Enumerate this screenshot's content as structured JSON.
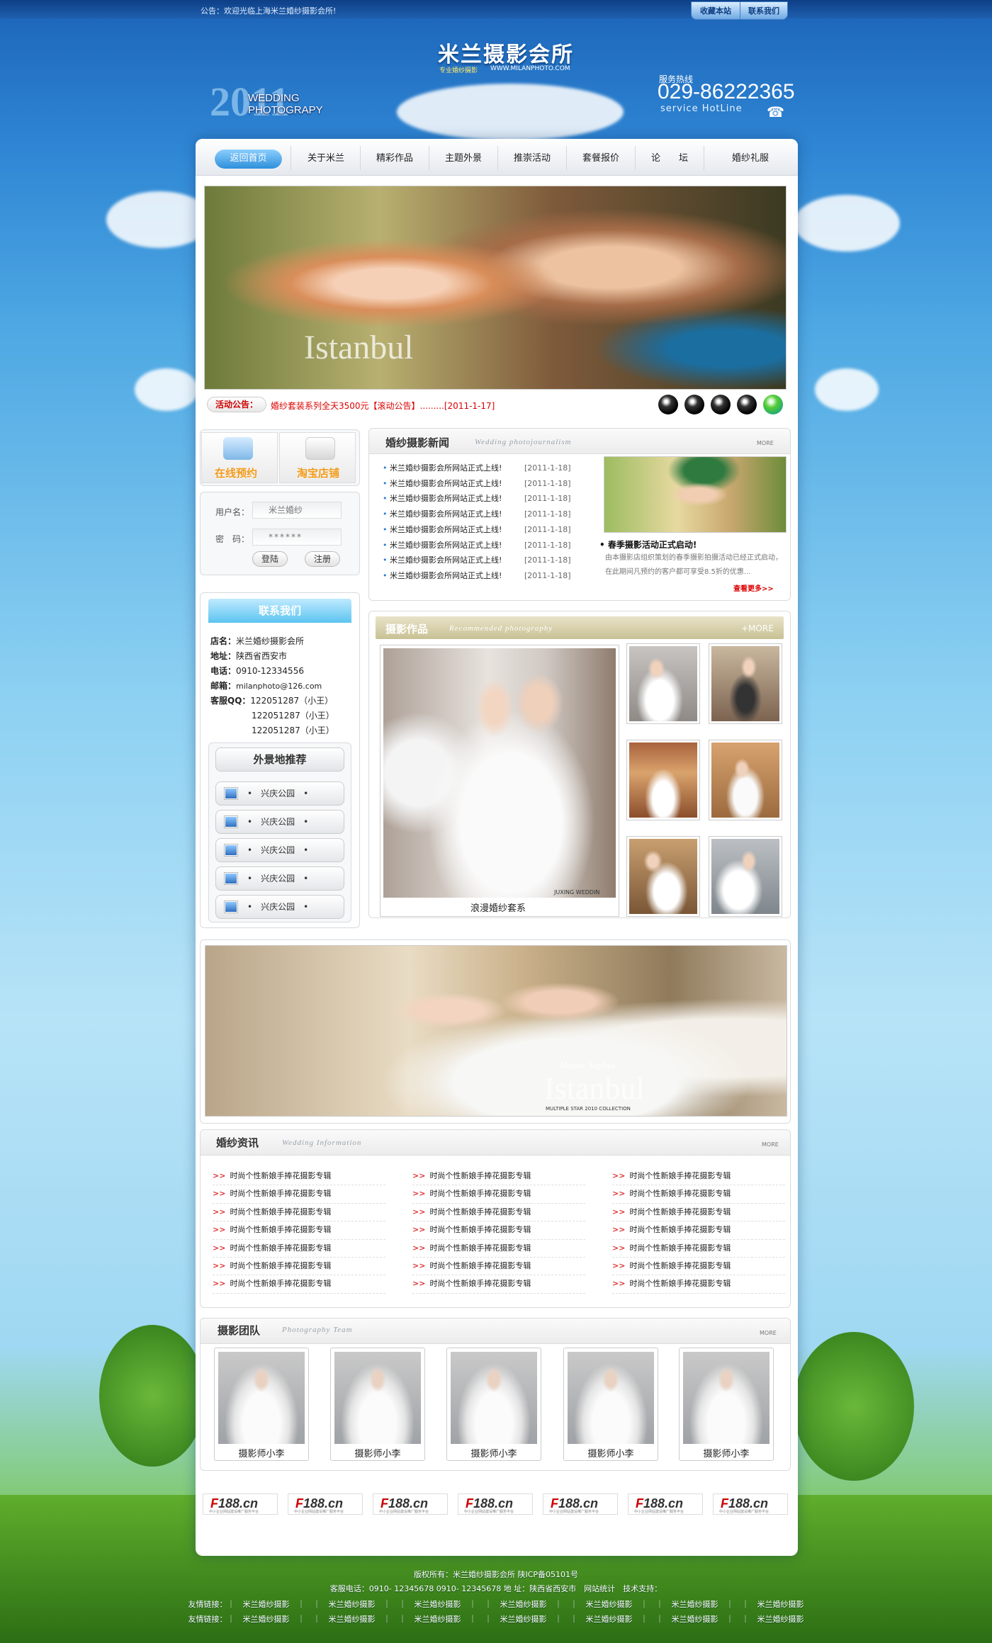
{
  "top": {
    "notice": "公告：欢迎光临上海米兰婚纱摄影会所!",
    "fav_label": "收藏本站",
    "contact_label": "联系我们"
  },
  "header": {
    "logo": "米兰摄影会所",
    "logo_sub": "专业婚纱摄影",
    "logo_url": "WWW.MILANPHOTO.COM",
    "hotline_label": "服务热线",
    "hotline": "029-86222365",
    "hotline_en": "service HotLine",
    "wedding_text": "WEDDING PHOTOGRAPY",
    "year": "2011"
  },
  "nav": [
    "返回首页",
    "关于米兰",
    "精彩作品",
    "主题外景",
    "推崇活动",
    "套餐报价",
    "论　　坛",
    "婚纱礼服"
  ],
  "banner1": {
    "watermark": "Istanbul"
  },
  "ticker": {
    "label": "活动公告：",
    "text": "婚纱套装系列全天3500元【滚动公告】.........[2011-1-17]"
  },
  "qq_icons": [
    "qq-icon",
    "qq-icon",
    "qq-icon",
    "qq-icon",
    "qq-green-icon"
  ],
  "services": [
    {
      "label": "在线预约"
    },
    {
      "label": "淘宝店铺"
    }
  ],
  "login": {
    "user_label": "用户名：",
    "user_value": "米兰婚纱",
    "pass_label": "密　码：",
    "pass_value": "******",
    "login_btn": "登陆",
    "register_btn": "注册"
  },
  "contact": {
    "title": "联系我们",
    "store_k": "店名：",
    "store_v": "米兰婚纱摄影会所",
    "addr_k": "地址：",
    "addr_v": "陕西省西安市",
    "tel_k": "电话：",
    "tel_v": "0910-12334556",
    "mail_k": "邮箱：",
    "mail_v": "milanphoto@126.com",
    "qq_k": "客服QQ：",
    "qq1": "122051287（小王）",
    "qq2": "122051287（小王）",
    "qq3": "122051287（小王）"
  },
  "locations": {
    "title": "外景地推荐",
    "items": [
      "•　兴庆公园　•",
      "•　兴庆公园　•",
      "•　兴庆公园　•",
      "•　兴庆公园　•",
      "•　兴庆公园　•"
    ]
  },
  "news": {
    "title": "婚纱摄影新闻",
    "title_en": "Wedding photojournalism",
    "more": "MORE",
    "items": [
      {
        "t": "米兰婚纱摄影会所网站正式上线!",
        "d": "[2011-1-18]"
      },
      {
        "t": "米兰婚纱摄影会所网站正式上线!",
        "d": "[2011-1-18]"
      },
      {
        "t": "米兰婚纱摄影会所网站正式上线!",
        "d": "[2011-1-18]"
      },
      {
        "t": "米兰婚纱摄影会所网站正式上线!",
        "d": "[2011-1-18]"
      },
      {
        "t": "米兰婚纱摄影会所网站正式上线!",
        "d": "[2011-1-18]"
      },
      {
        "t": "米兰婚纱摄影会所网站正式上线!",
        "d": "[2011-1-18]"
      },
      {
        "t": "米兰婚纱摄影会所网站正式上线!",
        "d": "[2011-1-18]"
      },
      {
        "t": "米兰婚纱摄影会所网站正式上线!",
        "d": "[2011-1-18]"
      }
    ],
    "feature_title": "• 春季摄影活动正式启动!",
    "feature_text": "由本摄影店组织策划的春季摄影拍摄活动已经正式启动，在此期间凡预约的客户都可享受8.5折的优惠...",
    "feature_more": "查看更多>>"
  },
  "works": {
    "title": "摄影作品",
    "title_en": "Recommended photography",
    "more": "+MORE",
    "caption": "浪漫婚纱套系",
    "watermark": "JUXING WEDDIN"
  },
  "banner2": {
    "watermark": "Istanbul",
    "watermark_top": "House Sophia",
    "watermark_sub": "MULTIPLE STAR 2010 COLLECTION"
  },
  "info": {
    "title": "婚纱资讯",
    "title_en": "Wedding Information",
    "more": "MORE",
    "cols": [
      [
        "时尚个性新娘手捧花摄影专辑",
        "时尚个性新娘手捧花摄影专辑",
        "时尚个性新娘手捧花摄影专辑",
        "时尚个性新娘手捧花摄影专辑",
        "时尚个性新娘手捧花摄影专辑",
        "时尚个性新娘手捧花摄影专辑",
        "时尚个性新娘手捧花摄影专辑"
      ],
      [
        "时尚个性新娘手捧花摄影专辑",
        "时尚个性新娘手捧花摄影专辑",
        "时尚个性新娘手捧花摄影专辑",
        "时尚个性新娘手捧花摄影专辑",
        "时尚个性新娘手捧花摄影专辑",
        "时尚个性新娘手捧花摄影专辑",
        "时尚个性新娘手捧花摄影专辑"
      ],
      [
        "时尚个性新娘手捧花摄影专辑",
        "时尚个性新娘手捧花摄影专辑",
        "时尚个性新娘手捧花摄影专辑",
        "时尚个性新娘手捧花摄影专辑",
        "时尚个性新娘手捧花摄影专辑",
        "时尚个性新娘手捧花摄影专辑",
        "时尚个性新娘手捧花摄影专辑"
      ]
    ],
    "arrow": ">>"
  },
  "team": {
    "title": "摄影团队",
    "title_en": "Photography Team",
    "more": "MORE",
    "members": [
      "摄影师小李",
      "摄影师小李",
      "摄影师小李",
      "摄影师小李",
      "摄影师小李"
    ]
  },
  "links": {
    "f": "F",
    "rest": "188.cn",
    "sub": "中小企业网站建设推广服务平台"
  },
  "footer": {
    "l1": "版权所有：米兰婚纱摄影会所 陕ICP备05101号",
    "l2": "客服电话：0910- 12345678 0910- 12345678 地 址：陕西省西安市　网站统计　技术支持：",
    "l3": "友情链接：｜　米兰婚纱摄影　｜　｜　米兰婚纱摄影　｜　｜　米兰婚纱摄影　｜　｜　米兰婚纱摄影　｜　｜　米兰婚纱摄影　｜　｜　米兰婚纱摄影　｜　｜　米兰婚纱摄影",
    "l4": "友情链接：｜　米兰婚纱摄影　｜　｜　米兰婚纱摄影　｜　｜　米兰婚纱摄影　｜　｜　米兰婚纱摄影　｜　｜　米兰婚纱摄影　｜　｜　米兰婚纱摄影　｜　｜　米兰婚纱摄影"
  }
}
